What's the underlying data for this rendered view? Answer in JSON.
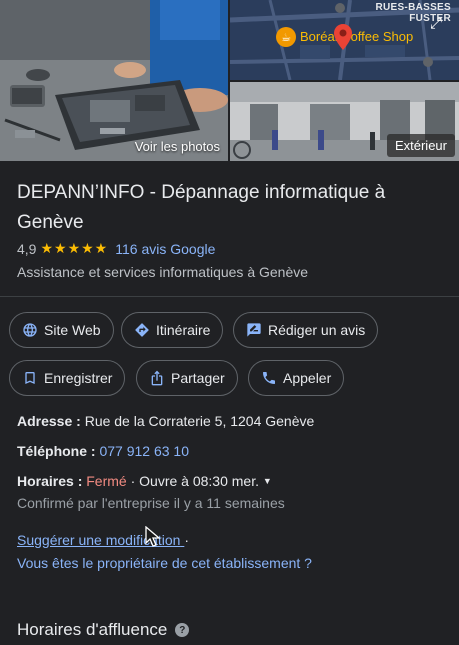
{
  "photos": {
    "main_label": "Voir les photos",
    "exterior_label": "Extérieur",
    "map_street": [
      "RUES-BASSES",
      "FUSTER"
    ],
    "map_poi": "Boréal Coffee Shop"
  },
  "place": {
    "title": "DEPANN’INFO - Dépannage informatique à Genève",
    "rating": "4,9",
    "stars": "★★★★★",
    "reviews": "116 avis Google",
    "category": "Assistance et services informatiques à Genève"
  },
  "actions": {
    "website": "Site Web",
    "directions": "Itinéraire",
    "review": "Rédiger un avis",
    "save": "Enregistrer",
    "share": "Partager",
    "call": "Appeler"
  },
  "details": {
    "address_label": "Adresse :",
    "address": "Rue de la Corraterie 5, 1204 Genève",
    "phone_label": "Téléphone :",
    "phone": "077 912 63 10",
    "hours_label": "Horaires :",
    "hours_status": "Fermé",
    "hours_next": "· Ouvre à 08:30 mer.",
    "hours_confirm": "Confirmé par l'entreprise il y a 11 semaines"
  },
  "links": {
    "suggest": "Suggérer une modification",
    "suggest_sep": "·",
    "owner": "Vous êtes le propriétaire de cet établissement ?"
  },
  "section": {
    "busy": "Horaires d'affluence"
  },
  "colors": {
    "background": "#202124",
    "link": "#8ab4f8",
    "closed": "#f28b82",
    "stars": "#fbbc04"
  }
}
